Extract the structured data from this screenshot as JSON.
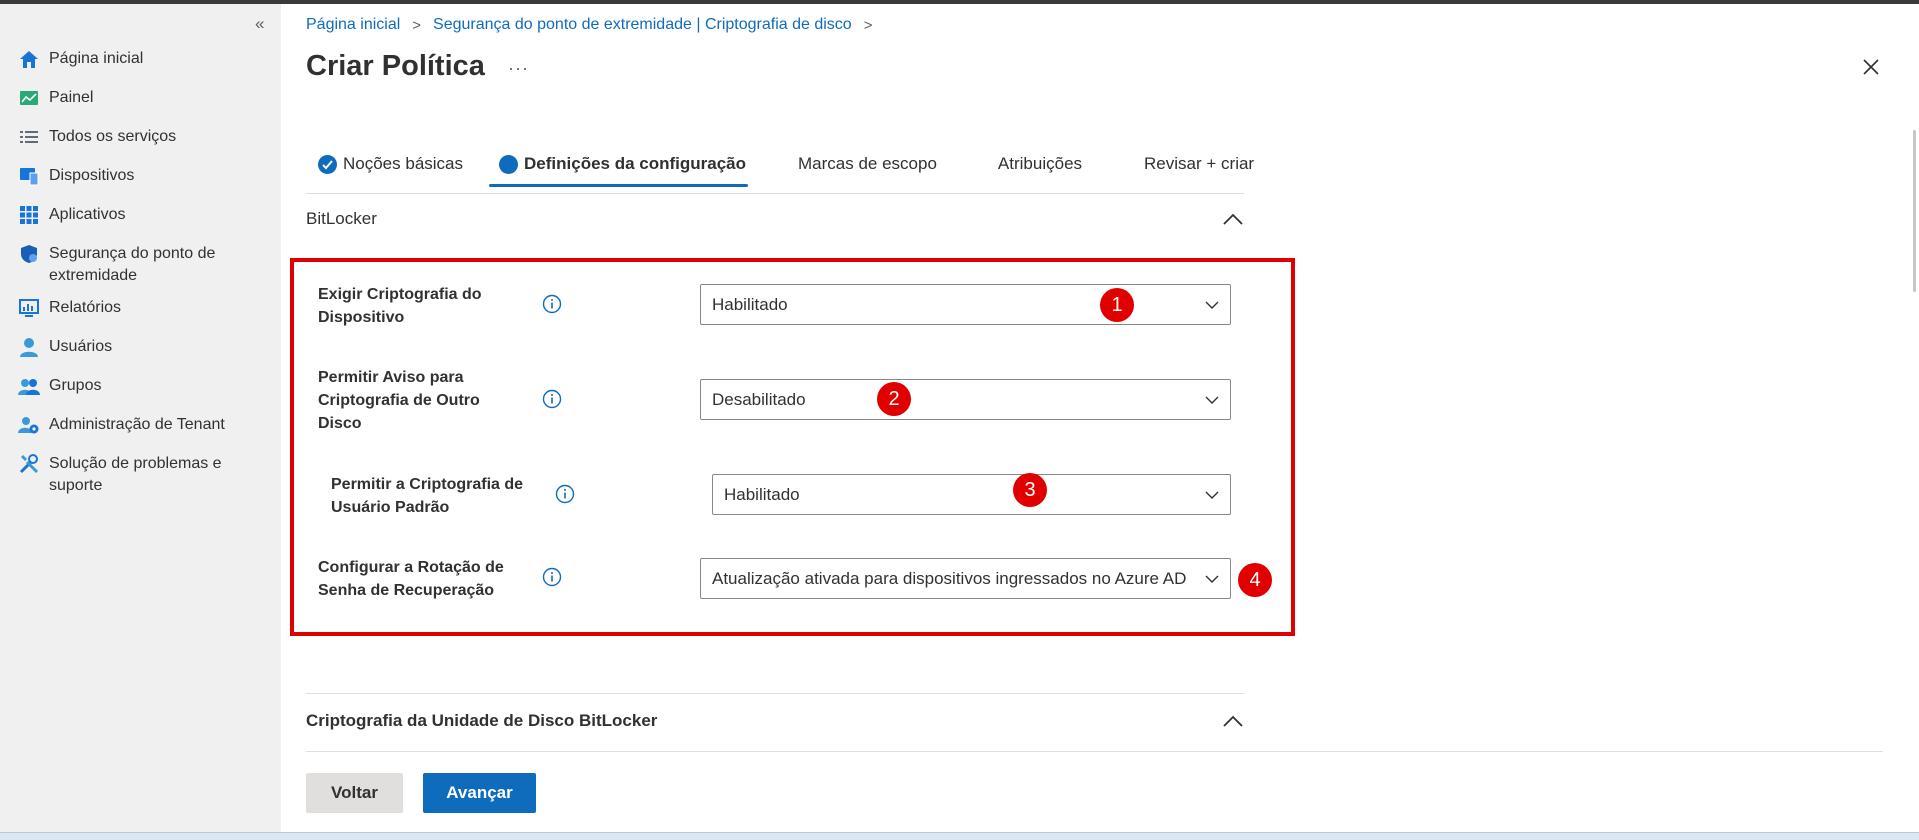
{
  "sidebar": {
    "items": [
      {
        "label": "Página inicial",
        "icon": "home-icon"
      },
      {
        "label": "Painel",
        "icon": "dashboard-icon"
      },
      {
        "label": "Todos os serviços",
        "icon": "list-icon"
      },
      {
        "label": "Dispositivos",
        "icon": "devices-icon"
      },
      {
        "label": "Aplicativos",
        "icon": "apps-grid-icon"
      },
      {
        "label": "Segurança do ponto de extremidade",
        "icon": "shield-icon"
      },
      {
        "label": "Relatórios",
        "icon": "reports-icon"
      },
      {
        "label": "Usuários",
        "icon": "user-icon"
      },
      {
        "label": "Grupos",
        "icon": "group-icon"
      },
      {
        "label": "Administração de Tenant",
        "icon": "tenant-admin-icon"
      },
      {
        "label": "Solução de problemas e suporte",
        "icon": "tools-icon"
      }
    ]
  },
  "breadcrumb": {
    "items": [
      "Página inicial",
      "Segurança do ponto de extremidade | Criptografia de disco"
    ]
  },
  "page": {
    "title": "Criar Política",
    "more": "···"
  },
  "tabs": [
    {
      "label": "Noções básicas",
      "state": "done"
    },
    {
      "label": "Definições da configuração",
      "state": "active"
    },
    {
      "label": "Marcas de escopo",
      "state": ""
    },
    {
      "label": "Atribuições",
      "state": ""
    },
    {
      "label": "Revisar + criar",
      "state": ""
    }
  ],
  "sections": {
    "bitlocker": "BitLocker",
    "disk_encryption": "Criptografia da Unidade de Disco BitLocker"
  },
  "settings": [
    {
      "label": "Exigir Criptografia do Dispositivo",
      "value": "Habilitado",
      "marker": "1"
    },
    {
      "label": "Permitir Aviso para Criptografia de Outro Disco",
      "value": "Desabilitado",
      "marker": "2"
    },
    {
      "label": "Permitir a Criptografia de Usuário Padrão",
      "value": "Habilitado",
      "marker": "3"
    },
    {
      "label": "Configurar a Rotação de Senha de Recuperação",
      "value": "Atualização ativada para dispositivos ingressados no Azure AD",
      "marker": "4"
    }
  ],
  "footer": {
    "back": "Voltar",
    "next": "Avançar"
  },
  "colors": {
    "accent": "#0f6cbd",
    "highlight": "#e00000",
    "sidebar_bg": "#f0f0f0"
  }
}
